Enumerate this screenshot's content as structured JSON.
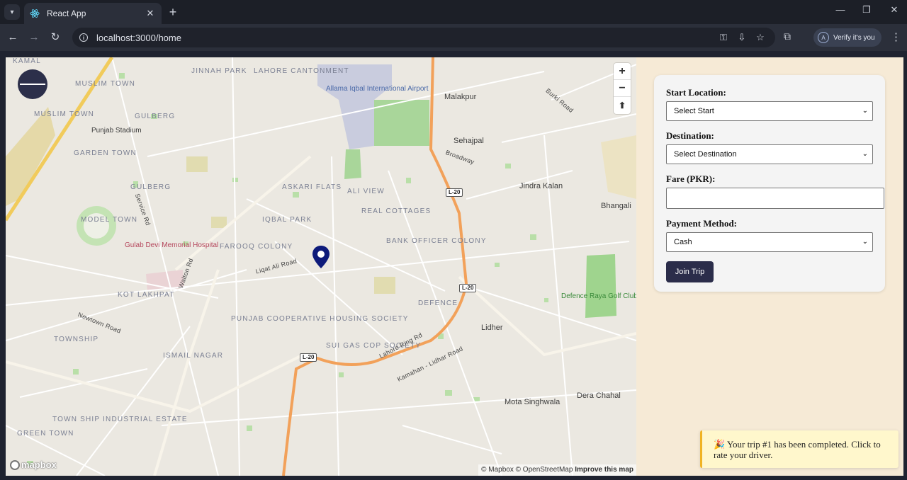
{
  "browser": {
    "tab_title": "React App",
    "url": "localhost:3000/home",
    "profile_label": "Verify it's you",
    "profile_initial": "A"
  },
  "map": {
    "labels": {
      "kamal": "KAMAL",
      "muslim_town_1": "MUSLIM TOWN",
      "muslim_town_2": "MUSLIM TOWN",
      "jinnah_park": "JINNAH PARK",
      "lahore_cantonment": "LAHORE CANTONMENT",
      "airport": "Allama Iqbal International Airport",
      "malakpur": "Malakpur",
      "burki_road": "Burki Road",
      "gulberg_1": "GULBERG",
      "punjab_stadium": "Punjab Stadium",
      "garden_town": "GARDEN TOWN",
      "sehajpal": "Sehajpal",
      "broadway": "Broadway",
      "askari_flats": "ASKARI FLATS",
      "ali_view": "ALI VIEW",
      "gulberg_2": "GULBERG",
      "jindra_kalan": "Jindra Kalan",
      "bhangali": "Bhangali",
      "iqbal_park": "IQBAL PARK",
      "real_cottages": "REAL COTTAGES",
      "model_town": "MODEL TOWN",
      "farooq_colony": "FAROOQ COLONY",
      "bank_officer_colony": "BANK OFFICER COLONY",
      "gulab_devi": "Gulab Devi Memorial Hospital",
      "liqat_ali_road": "Liqat Ali Road",
      "kot_lakhpat": "KOT LAKHPAT",
      "defence": "DEFENCE",
      "defence_raya": "Defence Raya Golf Club",
      "punjab_coop": "PUNJAB COOPERATIVE HOUSING SOCIETY",
      "lidher": "Lidher",
      "township": "TOWNSHIP",
      "sui_gas": "SUI GAS COP SOCIETY",
      "ismail_nagar": "ISMAIL NAGAR",
      "lahore_ring_rd": "Lahore Ring Rd",
      "kamahan_road": "Kamahan - Lidhar Road",
      "dera_chahal": "Dera Chahal",
      "mota_singhwala": "Mota Singhwala",
      "town_ship_industrial": "TOWN SHIP INDUSTRIAL ESTATE",
      "green_town": "GREEN TOWN",
      "newtown_road": "Newtown Road",
      "walton_rd": "Walton Rd",
      "service_rd": "Service Rd",
      "l20_a": "L-20",
      "l20_b": "L-20",
      "l20_c": "L-20"
    },
    "attribution_mapbox": "© Mapbox",
    "attribution_osm": "© OpenStreetMap",
    "attribution_improve": "Improve this map",
    "logo_text": "mapbox"
  },
  "form": {
    "start_label": "Start Location:",
    "start_value": "Select Start",
    "destination_label": "Destination:",
    "destination_value": "Select Destination",
    "fare_label": "Fare (PKR):",
    "fare_value": "",
    "payment_label": "Payment Method:",
    "payment_value": "Cash",
    "join_button": "Join Trip"
  },
  "toast": {
    "icon": "🎉",
    "message": "Your trip #1 has been completed. Click to rate your driver."
  },
  "colors": {
    "accent": "#2b2d4a",
    "page_bg": "#f6ead6",
    "toast_bg": "#fff7cc",
    "toast_border": "#f0b323",
    "ring_road": "#f2a15a"
  }
}
